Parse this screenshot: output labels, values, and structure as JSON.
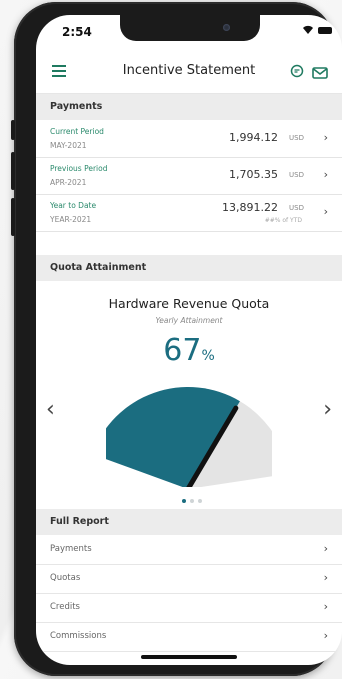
{
  "status": {
    "time": "2:54"
  },
  "header": {
    "title": "Incentive Statement",
    "menu_icon": "hamburger-menu-icon",
    "chat_icon": "chat-icon",
    "mail_icon": "mail-icon"
  },
  "payments": {
    "section_title": "Payments",
    "rows": [
      {
        "label": "Current Period",
        "date": "MAY-2021",
        "amount": "1,994.12",
        "currency": "USD",
        "sub": ""
      },
      {
        "label": "Previous Period",
        "date": "APR-2021",
        "amount": "1,705.35",
        "currency": "USD",
        "sub": ""
      },
      {
        "label": "Year to Date",
        "date": "YEAR-2021",
        "amount": "13,891.22",
        "currency": "USD",
        "sub": "##% of YTD"
      }
    ]
  },
  "quota": {
    "section_title": "Quota Attainment",
    "title": "Hardware Revenue Quota",
    "subtitle": "Yearly Attainment",
    "percent_value": "67",
    "percent_sign": "%",
    "attainment_fraction": 0.67,
    "colors": {
      "fill": "#1b6d80",
      "track": "#e4e4e4",
      "needle": "#111111"
    },
    "carousel_dots": 3,
    "active_dot": 0,
    "prev_arrow": "‹",
    "next_arrow": "›"
  },
  "full_report": {
    "section_title": "Full Report",
    "items": [
      "Payments",
      "Quotas",
      "Credits",
      "Commissions"
    ]
  },
  "accent_color": "#2b8a6c"
}
